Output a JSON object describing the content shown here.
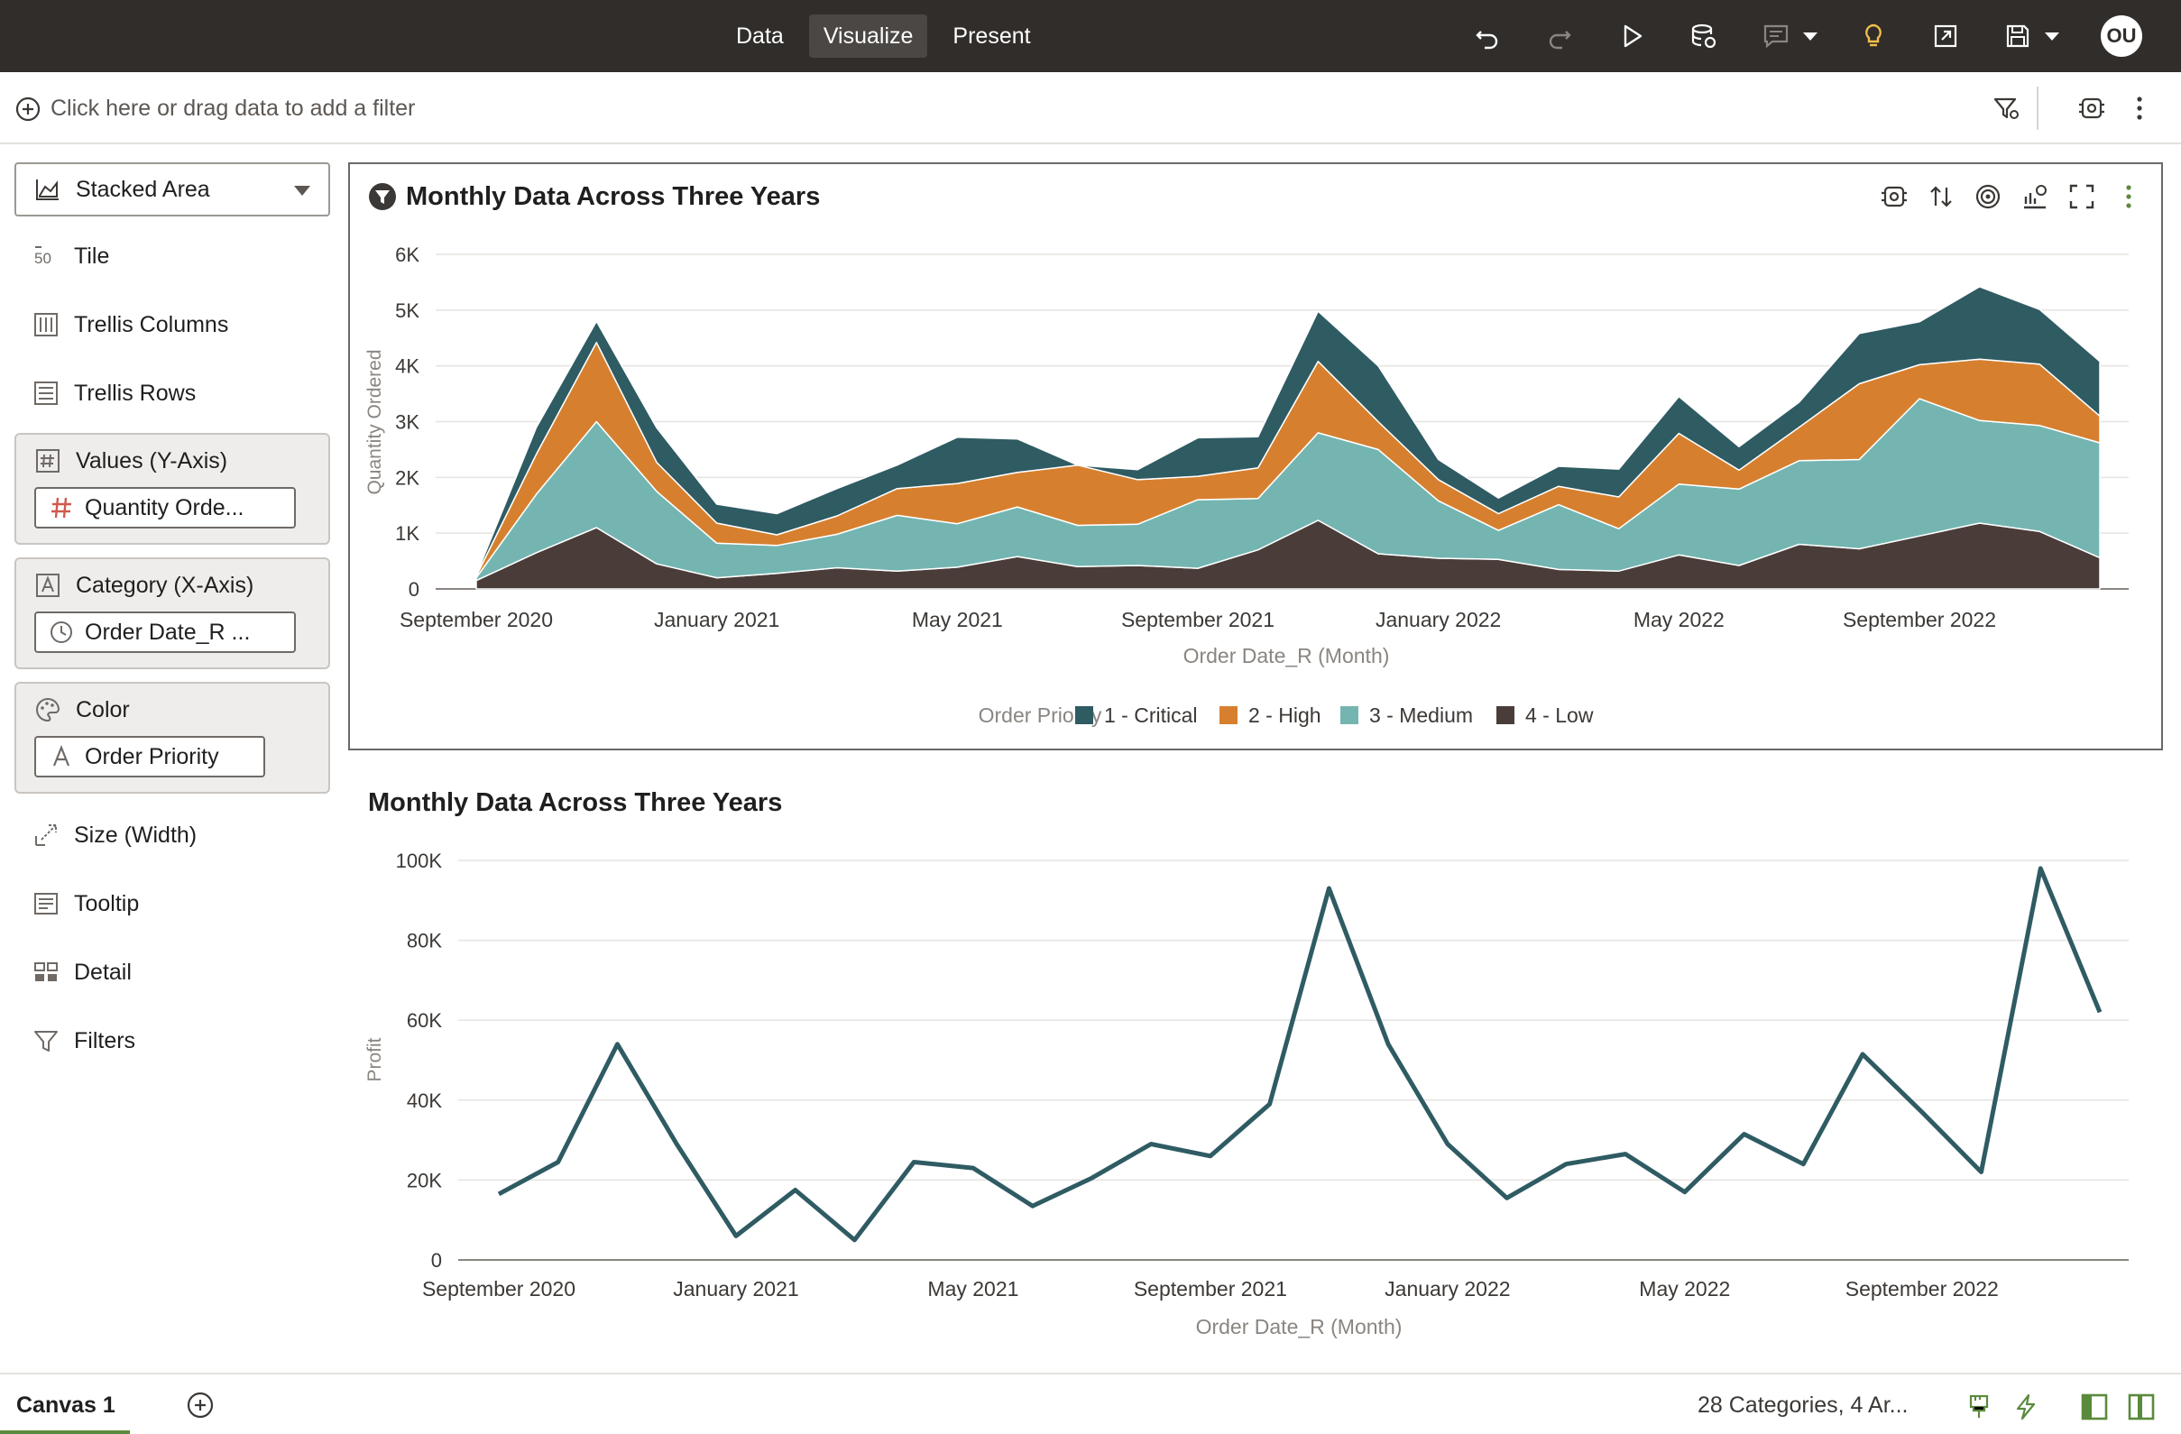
{
  "topbar": {
    "tabs": [
      {
        "label": "Data",
        "active": false
      },
      {
        "label": "Visualize",
        "active": true
      },
      {
        "label": "Present",
        "active": false
      }
    ],
    "user_initials": "OU",
    "icons": [
      "undo-icon",
      "redo-icon",
      "run-icon",
      "refresh-data-icon",
      "comment-icon",
      "auto-insights-icon",
      "export-icon",
      "save-icon"
    ],
    "colors": {
      "bar": "#312d2a",
      "insight": "#f2c14e"
    }
  },
  "filterbar": {
    "placeholder": "Click here or drag data to add a filter"
  },
  "grammar": {
    "viz_type": "Stacked Area",
    "rows": {
      "tile": "Tile",
      "trellis_columns": "Trellis Columns",
      "trellis_rows": "Trellis Rows",
      "size": "Size (Width)",
      "tooltip": "Tooltip",
      "detail": "Detail",
      "filters": "Filters"
    },
    "values": {
      "label": "Values (Y-Axis)",
      "pill": "Quantity Orde..."
    },
    "category": {
      "label": "Category (X-Axis)",
      "pill": "Order Date_R ..."
    },
    "color": {
      "label": "Color",
      "pill": "Order Priority"
    }
  },
  "chart_data": [
    {
      "type": "area",
      "stacked": true,
      "title": "Monthly Data Across Three Years",
      "xlabel": "Order Date_R (Month)",
      "ylabel": "Quantity Ordered",
      "ylim": [
        0,
        6000
      ],
      "yticks": [
        "0",
        "1K",
        "2K",
        "3K",
        "4K",
        "5K",
        "6K"
      ],
      "xticks": [
        {
          "label": "September 2020",
          "index": 0
        },
        {
          "label": "January 2021",
          "index": 4
        },
        {
          "label": "May 2021",
          "index": 8
        },
        {
          "label": "September 2021",
          "index": 12
        },
        {
          "label": "January 2022",
          "index": 16
        },
        {
          "label": "May 2022",
          "index": 20
        },
        {
          "label": "September 2022",
          "index": 24
        }
      ],
      "x": [
        "Sep 2020",
        "Oct 2020",
        "Nov 2020",
        "Dec 2020",
        "Jan 2021",
        "Feb 2021",
        "Mar 2021",
        "Apr 2021",
        "May 2021",
        "Jun 2021",
        "Jul 2021",
        "Aug 2021",
        "Sep 2021",
        "Oct 2021",
        "Nov 2021",
        "Dec 2021",
        "Jan 2022",
        "Feb 2022",
        "Mar 2022",
        "Apr 2022",
        "May 2022",
        "Jun 2022",
        "Jul 2022",
        "Aug 2022",
        "Sep 2022",
        "Oct 2022",
        "Nov 2022",
        "Dec 2022"
      ],
      "legend_title": "Order Priority",
      "legend_position": "bottom",
      "grid": true,
      "series": [
        {
          "name": "4 - Low",
          "color": "#4a3d39",
          "values": [
            150,
            650,
            1100,
            450,
            200,
            280,
            380,
            320,
            390,
            580,
            400,
            420,
            370,
            700,
            1230,
            630,
            550,
            530,
            350,
            320,
            610,
            420,
            800,
            720,
            950,
            1180,
            1030,
            560
          ]
        },
        {
          "name": "3 - Medium",
          "color": "#74b5b1",
          "values": [
            50,
            1050,
            1900,
            1300,
            620,
            500,
            600,
            1000,
            780,
            890,
            740,
            740,
            1230,
            920,
            1570,
            1870,
            1030,
            520,
            1160,
            760,
            1270,
            1370,
            1500,
            1600,
            2460,
            1840,
            1900,
            2060
          ]
        },
        {
          "name": "2 - High",
          "color": "#d6802f",
          "values": [
            30,
            720,
            1420,
            520,
            360,
            190,
            330,
            480,
            720,
            620,
            1080,
            800,
            420,
            550,
            1280,
            500,
            380,
            300,
            330,
            570,
            910,
            340,
            600,
            1360,
            610,
            1100,
            1100,
            480
          ]
        },
        {
          "name": "1 - Critical",
          "color": "#2f5b63",
          "values": [
            20,
            480,
            380,
            620,
            340,
            380,
            490,
            420,
            830,
            600,
            0,
            180,
            690,
            560,
            900,
            1000,
            360,
            280,
            360,
            500,
            660,
            420,
            450,
            900,
            770,
            1300,
            980,
            980
          ]
        }
      ]
    },
    {
      "type": "line",
      "title": "Monthly Data Across Three Years",
      "xlabel": "Order Date_R (Month)",
      "ylabel": "Profit",
      "ylim": [
        0,
        100000
      ],
      "yticks": [
        "0",
        "20K",
        "40K",
        "60K",
        "80K",
        "100K"
      ],
      "xticks": [
        {
          "label": "September 2020",
          "index": 0
        },
        {
          "label": "January 2021",
          "index": 4
        },
        {
          "label": "May 2021",
          "index": 8
        },
        {
          "label": "September 2021",
          "index": 12
        },
        {
          "label": "January 2022",
          "index": 16
        },
        {
          "label": "May 2022",
          "index": 20
        },
        {
          "label": "September 2022",
          "index": 24
        }
      ],
      "grid": true,
      "series": [
        {
          "name": "Profit",
          "color": "#2f5b63",
          "values": [
            16500,
            24500,
            54000,
            29000,
            6000,
            17500,
            5000,
            24500,
            23000,
            13500,
            20500,
            29000,
            26000,
            39000,
            93000,
            54000,
            29000,
            15500,
            24000,
            26500,
            17000,
            31500,
            24000,
            51500,
            37000,
            22000,
            98000,
            62000
          ]
        }
      ]
    }
  ],
  "footer": {
    "canvas_tab": "Canvas 1",
    "status": "28 Categories, 4 Ar..."
  }
}
